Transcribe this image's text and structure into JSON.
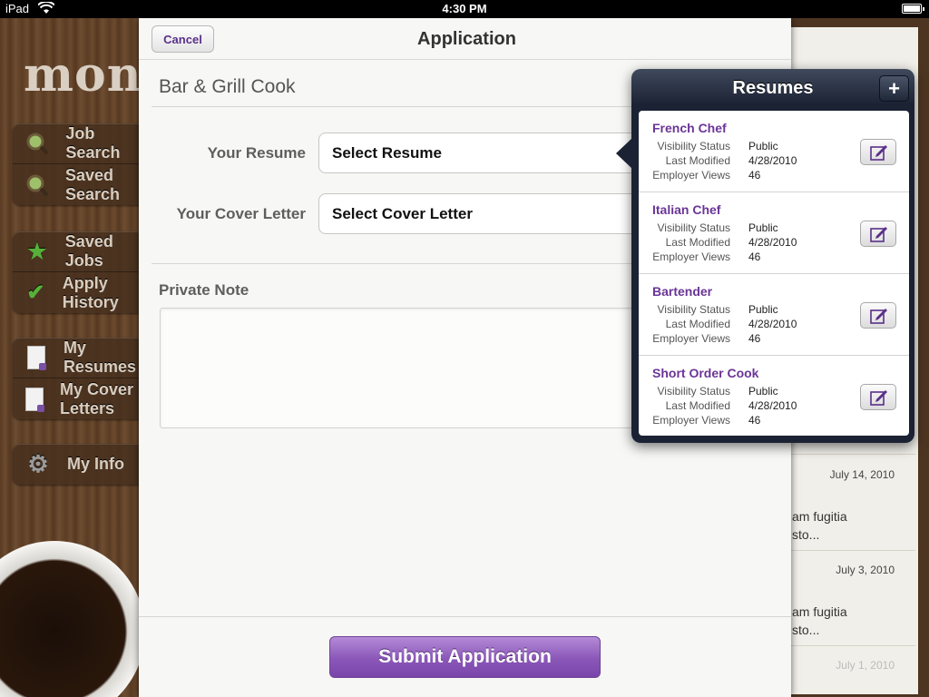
{
  "status_bar": {
    "carrier": "iPad",
    "time": "4:30 PM"
  },
  "background": {
    "logo": "mon",
    "sidebar_groups": [
      [
        {
          "label": "Job Search",
          "icon": "magnifier-icon"
        },
        {
          "label": "Saved Search",
          "icon": "magnifier-icon"
        }
      ],
      [
        {
          "label": "Saved Jobs",
          "icon": "star-icon"
        },
        {
          "label": "Apply History",
          "icon": "check-icon"
        }
      ],
      [
        {
          "label": "My Resumes",
          "icon": "document-icon"
        },
        {
          "label": "My Cover Letters",
          "icon": "document-icon"
        }
      ],
      [
        {
          "label": "My Info",
          "icon": "gear-icon"
        }
      ]
    ],
    "list_items": [
      {
        "date": "July 14, 2010",
        "snippet": "am fugitia sto..."
      },
      {
        "date": "July 3, 2010",
        "snippet": "am fugitia sto..."
      },
      {
        "date": "July 1, 2010",
        "snippet": ""
      }
    ]
  },
  "modal": {
    "cancel_label": "Cancel",
    "title": "Application",
    "job_title": "Bar & Grill Cook",
    "resume_label": "Your Resume",
    "resume_value": "Select Resume",
    "cover_label": "Your Cover Letter",
    "cover_value": "Select Cover Letter",
    "private_note_label": "Private Note",
    "private_note_value": "",
    "submit_label": "Submit Application"
  },
  "popover": {
    "title": "Resumes",
    "add_label": "+",
    "field_labels": {
      "visibility": "Visibility Status",
      "modified": "Last Modified",
      "views": "Employer Views"
    },
    "resumes": [
      {
        "name": "French Chef",
        "visibility": "Public",
        "modified": "4/28/2010",
        "views": "46"
      },
      {
        "name": "Italian Chef",
        "visibility": "Public",
        "modified": "4/28/2010",
        "views": "46"
      },
      {
        "name": "Bartender",
        "visibility": "Public",
        "modified": "4/28/2010",
        "views": "46"
      },
      {
        "name": "Short Order Cook",
        "visibility": "Public",
        "modified": "4/28/2010",
        "views": "46"
      }
    ]
  },
  "colors": {
    "accent": "#6a3597",
    "popover": "#1b2233",
    "button": "#8a57b8"
  }
}
